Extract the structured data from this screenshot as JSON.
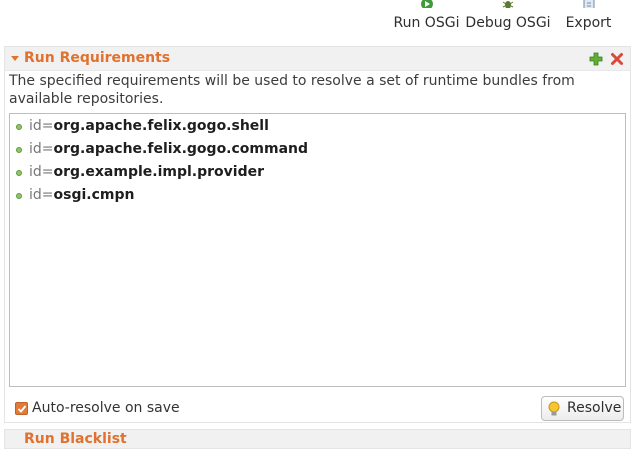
{
  "toolbar": {
    "run": {
      "label": "Run OSGi",
      "icon": "run-icon"
    },
    "debug": {
      "label": "Debug OSGi",
      "icon": "debug-bug-icon"
    },
    "export": {
      "label": "Export",
      "icon": "export-icon"
    }
  },
  "run_requirements": {
    "title": "Run Requirements",
    "description": "The specified requirements will be used to resolve a set of runtime bundles from available repositories.",
    "add_icon": "plus-icon",
    "remove_icon": "red-x-icon",
    "items": [
      {
        "prefix": "id=",
        "value": "org.apache.felix.gogo.shell"
      },
      {
        "prefix": "id=",
        "value": "org.apache.felix.gogo.command"
      },
      {
        "prefix": "id=",
        "value": "org.example.impl.provider"
      },
      {
        "prefix": "id=",
        "value": "osgi.cmpn"
      }
    ],
    "auto_resolve": {
      "label": "Auto-resolve on save",
      "checked": true
    },
    "resolve_button": {
      "label": "Resolve",
      "icon": "lightbulb-icon"
    }
  },
  "run_blacklist": {
    "title": "Run Blacklist"
  },
  "colors": {
    "section_title": "#e0712e",
    "bullet": "#8fc46b",
    "checkbox": "#e07b3a",
    "add_icon": "#4f9a2e",
    "remove_icon": "#d9483b"
  }
}
